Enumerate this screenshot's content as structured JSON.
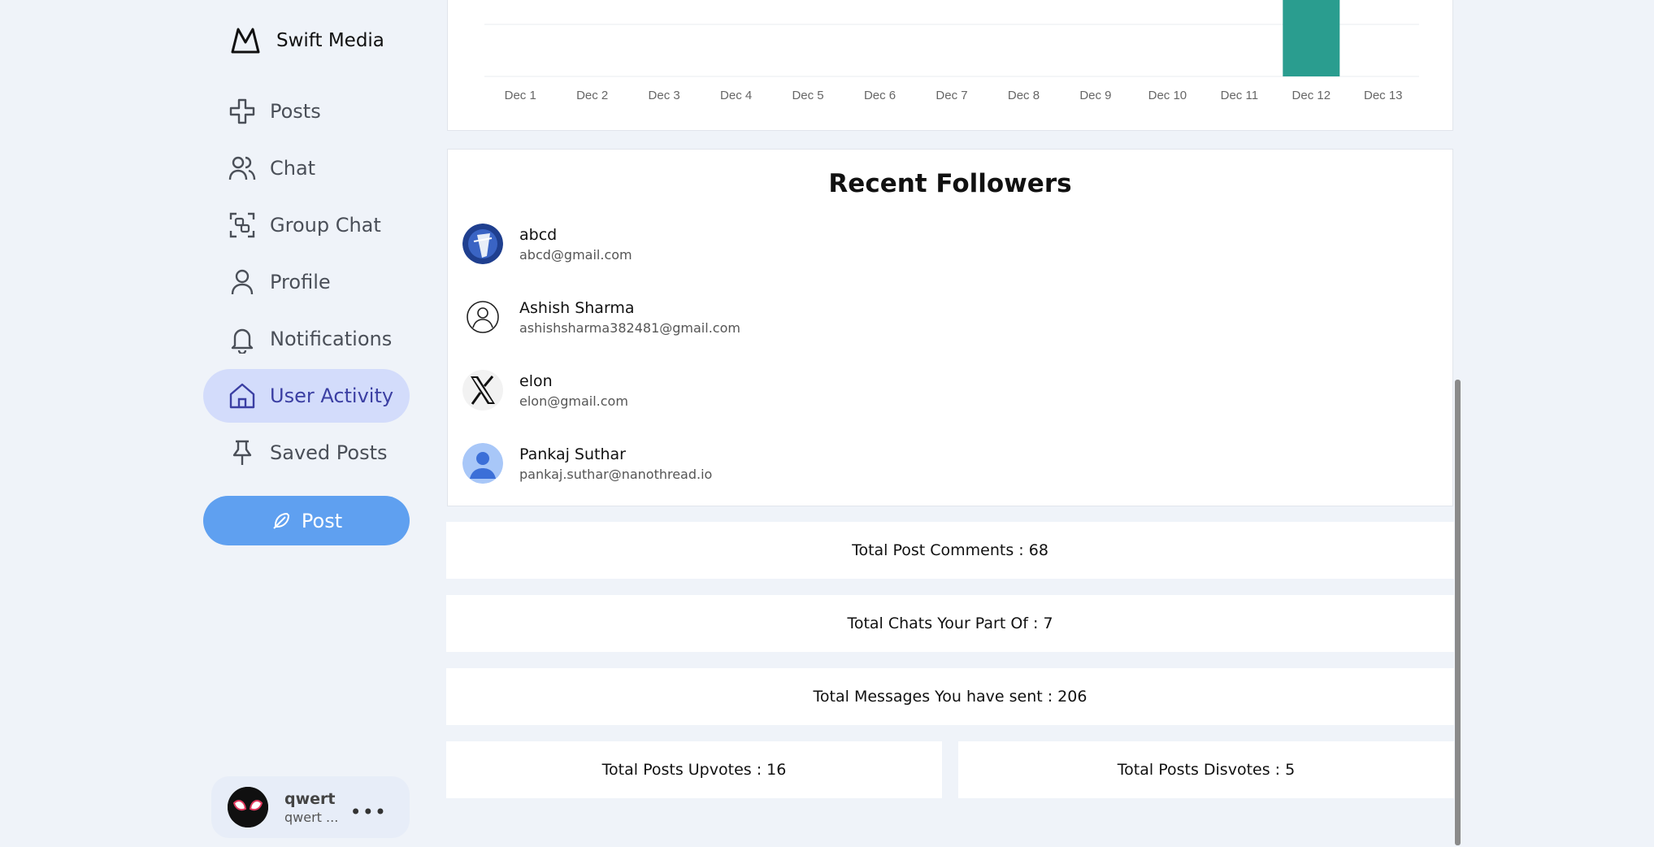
{
  "brand": {
    "name": "Swift Media",
    "icon": "mountain-logo-icon"
  },
  "nav": [
    {
      "key": "posts",
      "label": "Posts",
      "icon": "plus-icon",
      "active": false
    },
    {
      "key": "chat",
      "label": "Chat",
      "icon": "users-icon",
      "active": false
    },
    {
      "key": "group-chat",
      "label": "Group Chat",
      "icon": "group-icon",
      "active": false
    },
    {
      "key": "profile",
      "label": "Profile",
      "icon": "user-icon",
      "active": false
    },
    {
      "key": "notifications",
      "label": "Notifications",
      "icon": "bell-icon",
      "active": false
    },
    {
      "key": "user-activity",
      "label": "User Activity",
      "icon": "home-icon",
      "active": true
    },
    {
      "key": "saved-posts",
      "label": "Saved Posts",
      "icon": "pin-icon",
      "active": false
    }
  ],
  "post_button": {
    "label": "Post",
    "icon": "feather-icon"
  },
  "current_user": {
    "name": "qwert",
    "handle": "qwert ...",
    "menu_icon": "more-horizontal-icon"
  },
  "chart_data": {
    "type": "bar",
    "categories": [
      "Dec 1",
      "Dec 2",
      "Dec 3",
      "Dec 4",
      "Dec 5",
      "Dec 6",
      "Dec 7",
      "Dec 8",
      "Dec 9",
      "Dec 10",
      "Dec 11",
      "Dec 12",
      "Dec 13"
    ],
    "values": [
      0,
      0,
      0,
      0,
      0,
      0,
      0,
      0,
      0,
      0,
      0,
      1,
      0
    ],
    "bar_color": "#2a9d8f",
    "grid": true
  },
  "followers": {
    "title": "Recent Followers",
    "items": [
      {
        "name": "abcd",
        "email": "abcd@gmail.com",
        "avatar": "photo-avatar"
      },
      {
        "name": "Ashish Sharma",
        "email": "ashishsharma382481@gmail.com",
        "avatar": "user-outline-avatar"
      },
      {
        "name": "elon",
        "email": "elon@gmail.com",
        "avatar": "x-logo-avatar"
      },
      {
        "name": "Pankaj Suthar",
        "email": "pankaj.suthar@nanothread.io",
        "avatar": "default-person-avatar"
      }
    ]
  },
  "stats": {
    "comments": "Total Post Comments : 68",
    "chats": "Total Chats Your Part Of : 7",
    "messages": "Total Messages You have sent : 206",
    "upvotes": "Total Posts Upvotes : 16",
    "disvotes": "Total Posts Disvotes : 5"
  },
  "colors": {
    "background": "#eff3f9",
    "active_nav": "#d3dcfb",
    "post_button": "#5fa0f0",
    "bar": "#2a9d8f"
  }
}
